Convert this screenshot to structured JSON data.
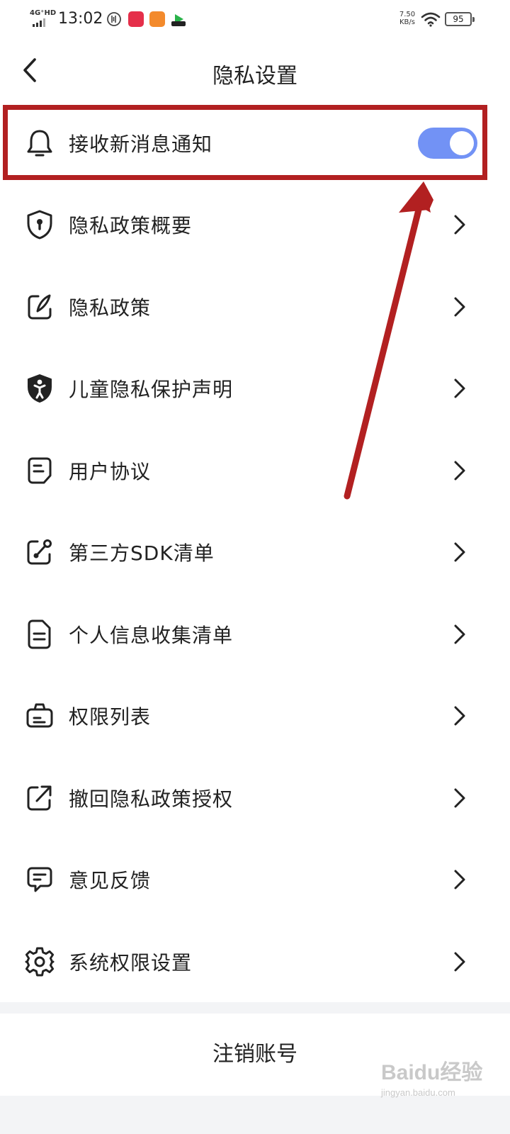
{
  "status_bar": {
    "network": "4G⁺HD",
    "time": "13:02",
    "speed_value": "7.50",
    "speed_unit": "KB/s",
    "battery": "95"
  },
  "header": {
    "title": "隐私设置"
  },
  "items": [
    {
      "label": "接收新消息通知",
      "icon": "bell-icon",
      "control": "toggle",
      "toggle_on": true
    },
    {
      "label": "隐私政策概要",
      "icon": "shield-keyhole-icon"
    },
    {
      "label": "隐私政策",
      "icon": "edit-note-icon"
    },
    {
      "label": "儿童隐私保护声明",
      "icon": "child-shield-icon"
    },
    {
      "label": "用户协议",
      "icon": "document-icon"
    },
    {
      "label": "第三方SDK清单",
      "icon": "share-link-icon"
    },
    {
      "label": "个人信息收集清单",
      "icon": "file-list-icon"
    },
    {
      "label": "权限列表",
      "icon": "briefcase-icon"
    },
    {
      "label": "撤回隐私政策授权",
      "icon": "revoke-arrow-icon"
    },
    {
      "label": "意见反馈",
      "icon": "feedback-chat-icon"
    },
    {
      "label": "系统权限设置",
      "icon": "gear-icon"
    }
  ],
  "logout": {
    "label": "注销账号"
  },
  "watermark": {
    "main": "Baidu经验",
    "sub": "jingyan.baidu.com"
  },
  "colors": {
    "toggle_on": "#7292f5",
    "annotation": "#b22021"
  }
}
